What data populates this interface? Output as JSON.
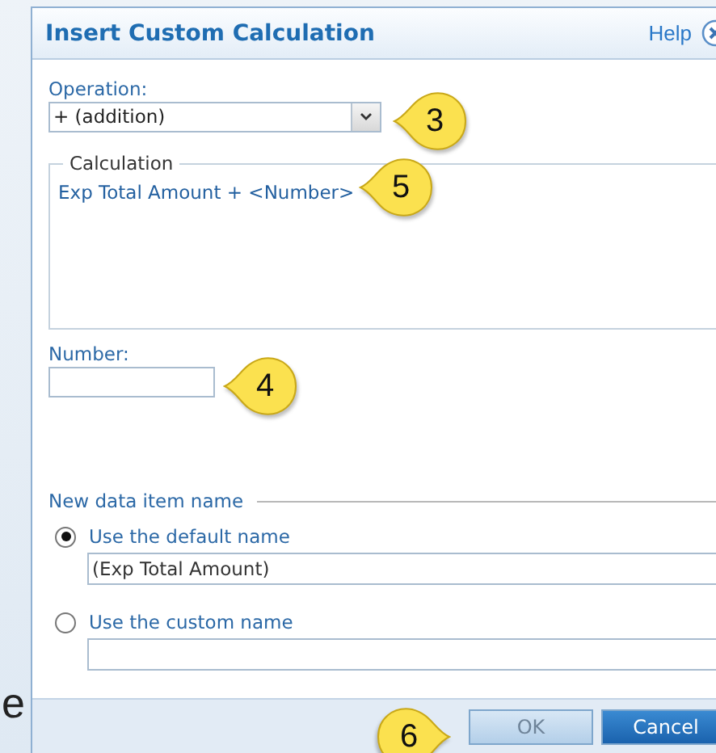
{
  "background_text": "e",
  "dialog": {
    "title": "Insert Custom Calculation",
    "help": "Help",
    "operation": {
      "label": "Operation:",
      "value": "+ (addition)",
      "callout": "3"
    },
    "calculation": {
      "legend": "Calculation",
      "expression": "Exp Total Amount + <Number>",
      "callout": "5"
    },
    "number": {
      "label": "Number:",
      "callout": "4"
    },
    "new_name": {
      "legend": "New data item name",
      "options": [
        {
          "label": "Use the default name",
          "selected": true,
          "value": "(Exp Total Amount)"
        },
        {
          "label": "Use the custom name",
          "selected": false
        }
      ]
    },
    "footer": {
      "callout": "6",
      "buttons": [
        {
          "label": "OK",
          "disabled": true
        },
        {
          "label": "Cancel",
          "disabled": false
        }
      ]
    }
  }
}
